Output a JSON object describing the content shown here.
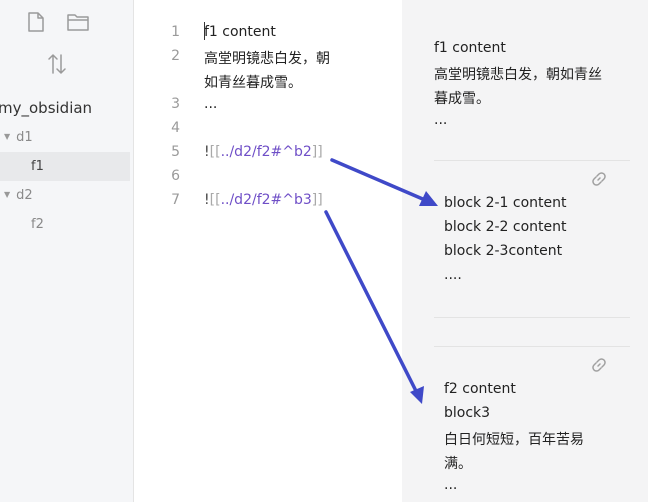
{
  "sidebar": {
    "vault_name": "my_obsidian",
    "tree": [
      {
        "type": "folder",
        "name": "d1"
      },
      {
        "type": "file",
        "name": "f1",
        "active": true
      },
      {
        "type": "folder",
        "name": "d2"
      },
      {
        "type": "file",
        "name": "f2",
        "active": false
      }
    ]
  },
  "editor": {
    "lines": [
      {
        "num": "1",
        "text": "f1 content"
      },
      {
        "num": "2",
        "text": "高堂明镜悲白发，朝",
        "cont": "如青丝暮成雪。"
      },
      {
        "num": "3",
        "text": "..."
      },
      {
        "num": "4",
        "text": ""
      },
      {
        "num": "5",
        "bang": "!",
        "open": "[[",
        "link": "../d2/f2#^b2",
        "close": "]]"
      },
      {
        "num": "6",
        "text": ""
      },
      {
        "num": "7",
        "bang": "!",
        "open": "[[",
        "link": "../d2/f2#^b3",
        "close": "]]"
      }
    ]
  },
  "preview": {
    "top": [
      "f1 content",
      "高堂明镜悲白发，朝如青丝",
      "暮成雪。",
      "..."
    ],
    "embed1": [
      "block 2-1 content",
      "block 2-2 content",
      "block 2-3content",
      "...."
    ],
    "embed2": [
      "f2 content",
      "block3",
      "白日何短短，百年苦易",
      "满。",
      "..."
    ]
  },
  "colors": {
    "arrow": "#3f49c8",
    "link": "#6f4fc7",
    "sidebar_bg": "#f5f6f8",
    "preview_bg": "#f4f4f5"
  }
}
